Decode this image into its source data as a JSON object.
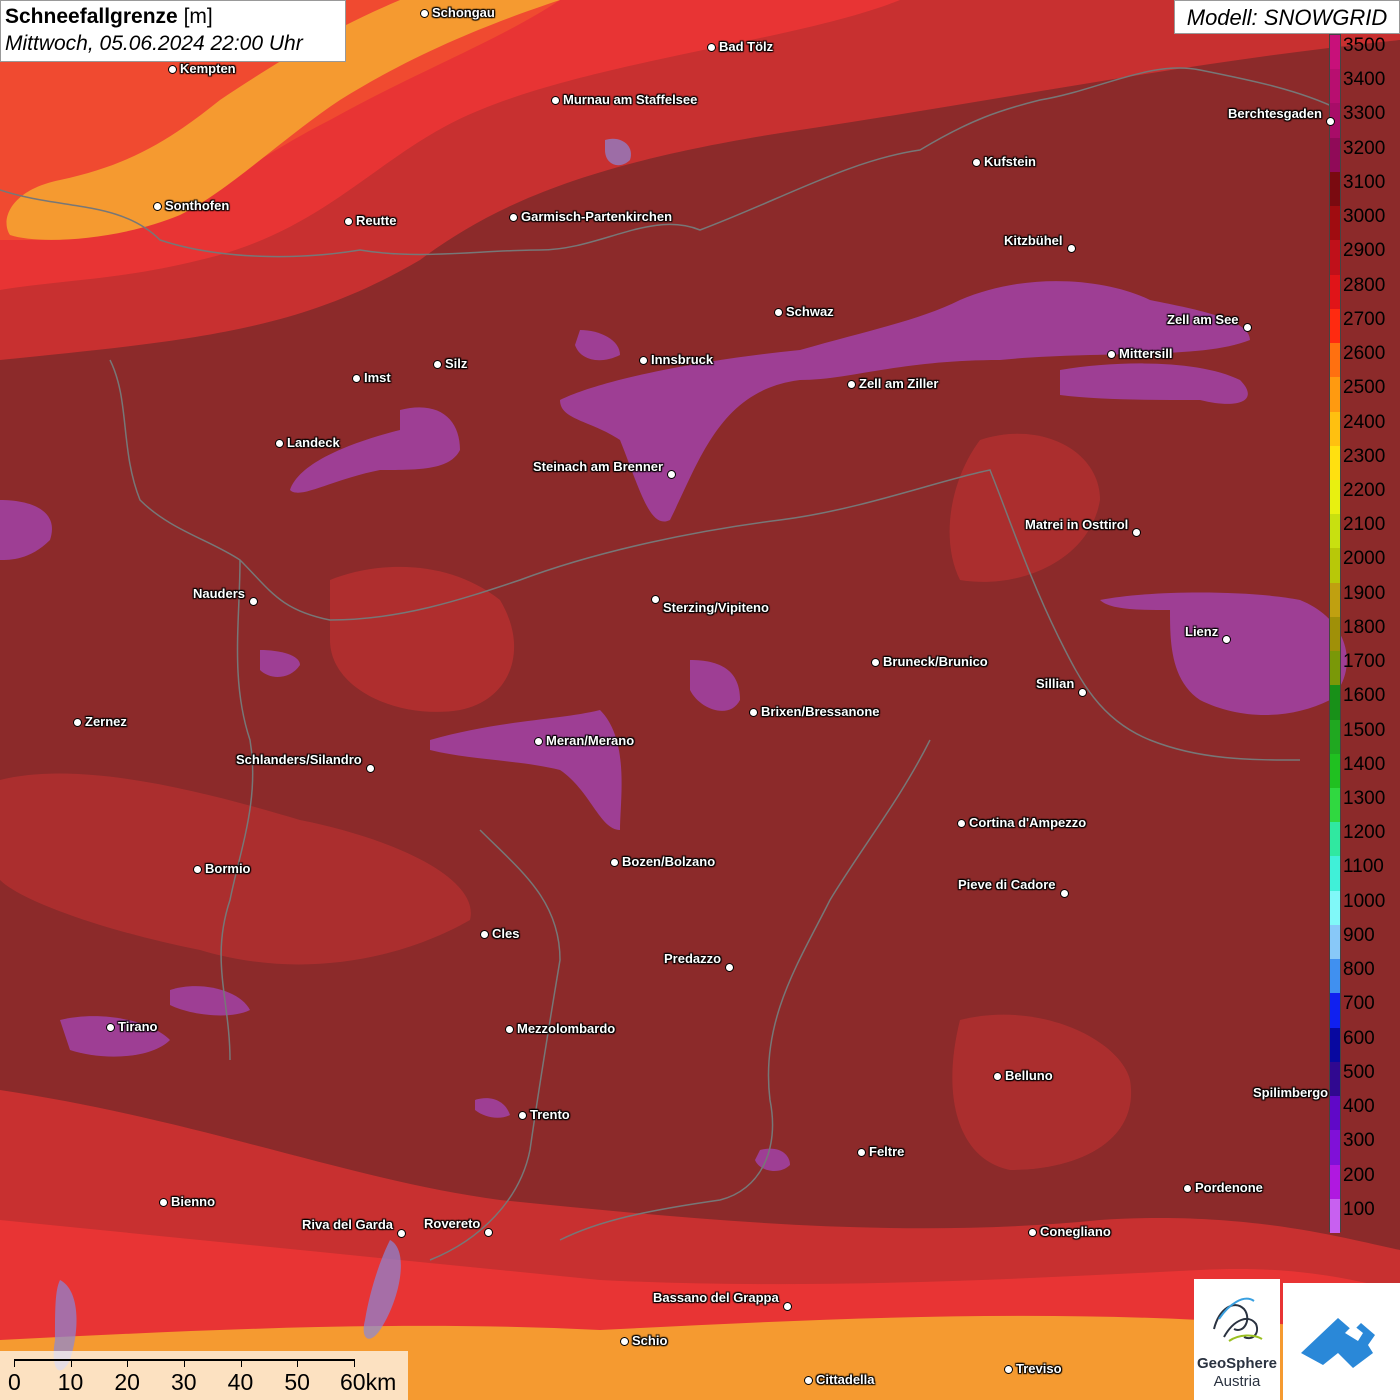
{
  "title": {
    "main_bold": "Schneefallgrenze",
    "main_unit": "[m]",
    "date": "Mittwoch, 05.06.2024 22:00 Uhr"
  },
  "model": "Modell: SNOWGRID",
  "legend": {
    "labels": [
      "3500",
      "3400",
      "3300",
      "3200",
      "3100",
      "3000",
      "2900",
      "2800",
      "2700",
      "2600",
      "2500",
      "2400",
      "2300",
      "2200",
      "2100",
      "2000",
      "1900",
      "1800",
      "1700",
      "1600",
      "1500",
      "1400",
      "1300",
      "1200",
      "1100",
      "1000",
      "900",
      "800",
      "700",
      "600",
      "500",
      "400",
      "300",
      "200",
      "100"
    ],
    "colors": [
      "#c8107a",
      "#b80e70",
      "#a80c68",
      "#900a58",
      "#7a0a10",
      "#a00c10",
      "#c0101a",
      "#e01418",
      "#ff2a10",
      "#ff7010",
      "#ff9a10",
      "#ffc010",
      "#ffe010",
      "#e8f010",
      "#c8e010",
      "#b8c808",
      "#c0a010",
      "#a09008",
      "#7a9808",
      "#189018",
      "#20a820",
      "#20c020",
      "#30d840",
      "#30e8a0",
      "#40f0d8",
      "#80f8f8",
      "#88c8f8",
      "#4090f0",
      "#1020f0",
      "#0808a0",
      "#300890",
      "#6008c8",
      "#8010d8",
      "#b018e0",
      "#c860f0"
    ]
  },
  "cities": [
    {
      "name": "Schongau"
    },
    {
      "name": "Kempten"
    },
    {
      "name": "Bad Tölz"
    },
    {
      "name": "Murnau am Staffelsee"
    },
    {
      "name": "Berchtesgaden"
    },
    {
      "name": "Kufstein"
    },
    {
      "name": "Sonthofen"
    },
    {
      "name": "Reutte"
    },
    {
      "name": "Garmisch-Partenkirchen"
    },
    {
      "name": "Kitzbühel"
    },
    {
      "name": "Schwaz"
    },
    {
      "name": "Zell am See"
    },
    {
      "name": "Innsbruck"
    },
    {
      "name": "Mittersill"
    },
    {
      "name": "Imst"
    },
    {
      "name": "Silz"
    },
    {
      "name": "Zell am Ziller"
    },
    {
      "name": "Landeck"
    },
    {
      "name": "Steinach am Brenner"
    },
    {
      "name": "Matrei in Osttirol"
    },
    {
      "name": "Nauders"
    },
    {
      "name": "Sterzing/Vipiteno"
    },
    {
      "name": "Lienz"
    },
    {
      "name": "Bruneck/Brunico"
    },
    {
      "name": "Sillian"
    },
    {
      "name": "Zernez"
    },
    {
      "name": "Brixen/Bressanone"
    },
    {
      "name": "Meran/Merano"
    },
    {
      "name": "Schlanders/Silandro"
    },
    {
      "name": "Cortina d'Ampezzo"
    },
    {
      "name": "Bormio"
    },
    {
      "name": "Bozen/Bolzano"
    },
    {
      "name": "Pieve di Cadore"
    },
    {
      "name": "Cles"
    },
    {
      "name": "Predazzo"
    },
    {
      "name": "Tirano"
    },
    {
      "name": "Mezzolombardo"
    },
    {
      "name": "Belluno"
    },
    {
      "name": "Spilimbergo"
    },
    {
      "name": "Trento"
    },
    {
      "name": "Feltre"
    },
    {
      "name": "Pordenone"
    },
    {
      "name": "Bienno"
    },
    {
      "name": "Riva del Garda"
    },
    {
      "name": "Rovereto"
    },
    {
      "name": "Conegliano"
    },
    {
      "name": "Bassano del Grappa"
    },
    {
      "name": "Schio"
    },
    {
      "name": "Treviso"
    },
    {
      "name": "Cittadella"
    }
  ],
  "scale": {
    "labels": [
      "0",
      "10",
      "20",
      "30",
      "40",
      "50",
      "60km"
    ]
  },
  "logo": {
    "name": "GeoSphere",
    "sub": "Austria"
  },
  "colors": {
    "dominant": "#8c2a2a",
    "band_red": "#e83030",
    "band_orange": "#f59a30",
    "band_purple": "#a040a0"
  }
}
